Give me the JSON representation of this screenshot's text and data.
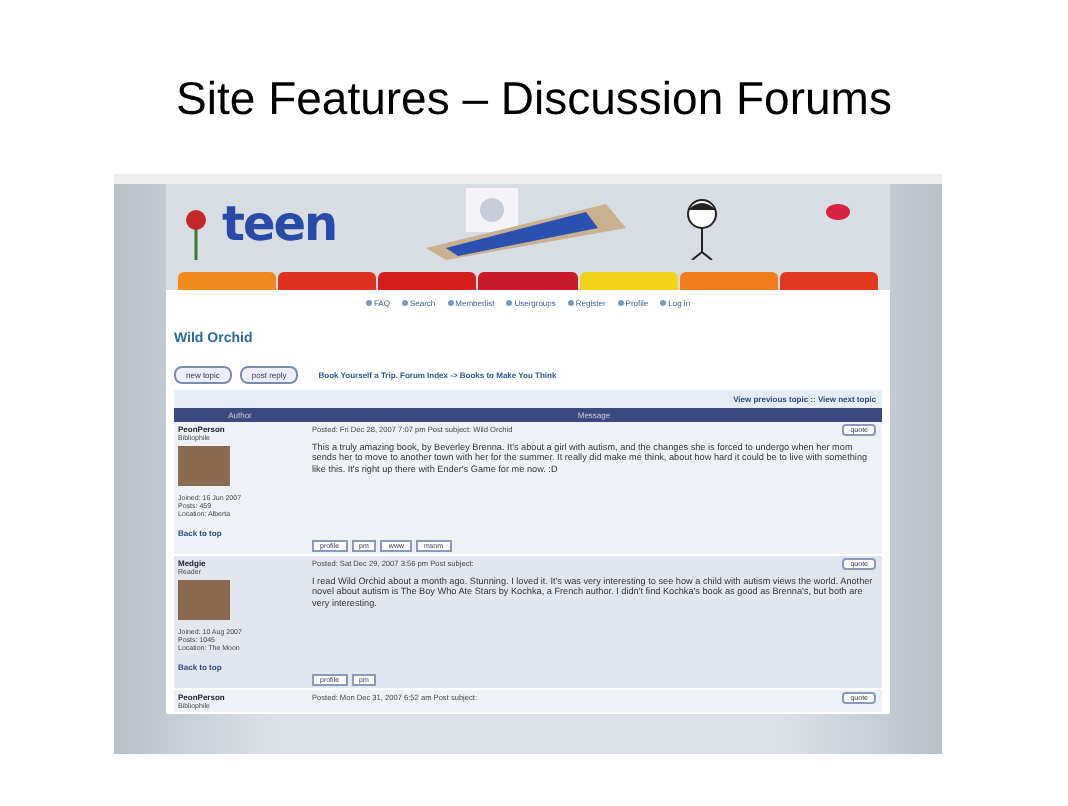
{
  "slide": {
    "title": "Site Features – Discussion Forums"
  },
  "site": {
    "logo": "teen",
    "nav_tabs": [
      {
        "color": "#f08a1c"
      },
      {
        "color": "#e0301e"
      },
      {
        "color": "#d41e1e"
      },
      {
        "color": "#c81a2a"
      },
      {
        "color": "#f2d21a"
      },
      {
        "color": "#f07c1a"
      },
      {
        "color": "#e2381e"
      }
    ],
    "menu": [
      "FAQ",
      "Search",
      "Memberlist",
      "Usergroups",
      "Register",
      "Profile",
      "Log in"
    ],
    "topic_title": "Wild Orchid",
    "buttons": [
      "new topic",
      "post reply"
    ],
    "breadcrumb": "Book Yourself a Trip. Forum Index -> Books to Make You Think",
    "topic_nav": "View previous topic :: View next topic",
    "columns": [
      "Author",
      "Message"
    ],
    "posts": [
      {
        "author": "PeonPerson",
        "rank": "Bibliophile",
        "joined": "Joined: 16 Jun 2007",
        "posts": "Posts: 459",
        "location": "Location: Alberta",
        "posted": "Posted: Fri Dec 28, 2007 7:07 pm    Post subject: Wild Orchid",
        "quote": "quote",
        "body": "This a truly amazing book, by Beverley Brenna. It's about a girl with autism, and the changes she is forced to undergo when her mom sends her to move to another town with her for the summer. It really did make me think, about how hard it could be to live with something like this. It's right up there with Ender's Game for me now. :D",
        "back": "Back to top",
        "actions": [
          "profile",
          "pm",
          "www",
          "msnm"
        ]
      },
      {
        "author": "Medgie",
        "rank": "Reader",
        "joined": "Joined: 10 Aug 2007",
        "posts": "Posts: 1045",
        "location": "Location: The Moon",
        "posted": "Posted: Sat Dec 29, 2007 3:56 pm    Post subject:",
        "quote": "quote",
        "body": "I read Wild Orchid about a month ago. Stunning. I loved it. It's was very interesting to see how a child with autism views the world. Another novel about autism is The Boy Who Ate Stars by Kochka, a French author. I didn't find Kochka's book as good as Brenna's, but both are very interesting.",
        "back": "Back to top",
        "actions": [
          "profile",
          "pm"
        ]
      },
      {
        "author": "PeonPerson",
        "rank": "Bibliophile",
        "posted": "Posted: Mon Dec 31, 2007 6:52 am    Post subject:",
        "quote": "quote"
      }
    ]
  }
}
